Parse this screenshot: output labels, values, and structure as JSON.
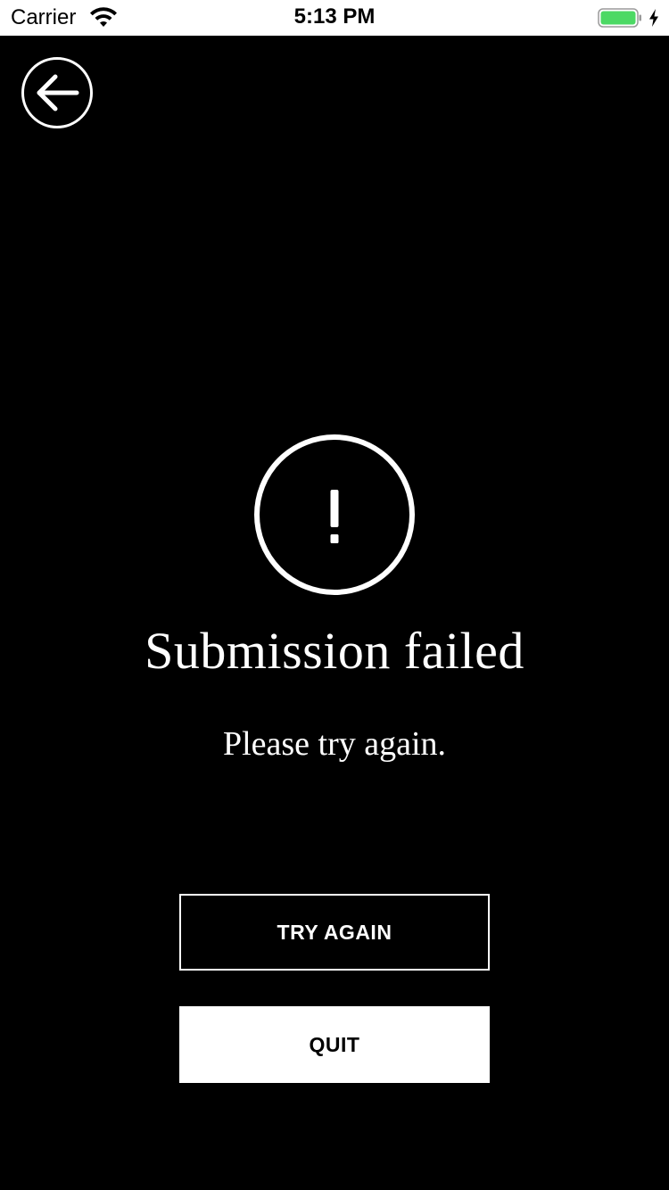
{
  "status_bar": {
    "carrier": "Carrier",
    "time": "5:13 PM",
    "battery_color": "#4cd964",
    "wifi_icon": "wifi-icon",
    "charging_icon": "bolt-icon"
  },
  "nav": {
    "back_icon": "arrow-left-icon"
  },
  "alert": {
    "icon": "exclamation-icon",
    "title": "Submission failed",
    "message": "Please try again."
  },
  "actions": {
    "try_again_label": "TRY AGAIN",
    "quit_label": "QUIT"
  },
  "colors": {
    "background": "#000000",
    "foreground": "#ffffff"
  }
}
